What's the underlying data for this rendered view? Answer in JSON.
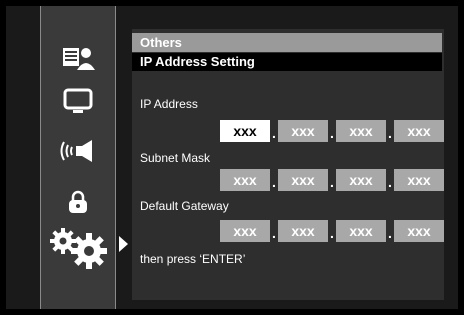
{
  "header": {
    "category": "Others",
    "title": "IP Address Setting"
  },
  "sidebar": {
    "items": [
      {
        "icon": "disc-user-icon"
      },
      {
        "icon": "tv-screen-icon"
      },
      {
        "icon": "speaker-audio-icon"
      },
      {
        "icon": "lock-icon"
      },
      {
        "icon": "gears-icon",
        "selected": true
      }
    ]
  },
  "fields": {
    "ip_address": {
      "label": "IP Address",
      "octets": [
        "xxx",
        "xxx",
        "xxx",
        "xxx"
      ]
    },
    "subnet_mask": {
      "label": "Subnet Mask",
      "octets": [
        "xxx",
        "xxx",
        "xxx",
        "xxx"
      ]
    },
    "default_gateway": {
      "label": "Default Gateway",
      "octets": [
        "xxx",
        "xxx",
        "xxx",
        "xxx"
      ]
    }
  },
  "footer": {
    "instruction": "then press ‘ENTER’"
  },
  "separator": "."
}
